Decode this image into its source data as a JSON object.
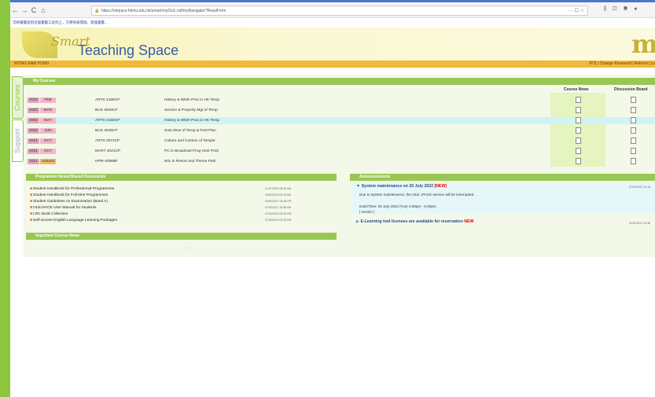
{
  "browser": {
    "nav": [
      "←",
      "→",
      "C",
      "⌂"
    ],
    "url": "https://olepace.hkmu.edu.hk/smart/myOLE.nsf/myNavigator?ReadForm",
    "url_icons": "··· ☐ ☆",
    "toolbar_icons": "⫼ ◫ ◉ ●",
    "notice": "可將書籤放到這個書籤工具列上，方便快速開啟。管理書籤..."
  },
  "header": {
    "logo_smart": "Smart",
    "logo_text": "Teaching Space",
    "brand_mark": "mu"
  },
  "userbar": {
    "username": "WONG KAM PONG",
    "links": [
      "中文",
      "Change Password",
      "Refresh",
      "Lo"
    ]
  },
  "side_tabs": [
    "Courses",
    "Support"
  ],
  "courses": {
    "title": "My Courses",
    "col_news": "Course News",
    "col_board": "Discussion Board",
    "rows": [
      {
        "year": "2022",
        "term": "FEB",
        "code": "ARTS 4158CP",
        "name": "History & Wksh Prac in HK Temp"
      },
      {
        "year": "2022",
        "term": "MAR",
        "code": "BUS 3028CP",
        "name": "Service & Property Mgt of Temp"
      },
      {
        "year": "2022",
        "term": "MAY",
        "code": "ARTS 4158CP",
        "name": "History & Wksh Prac in HK Temp"
      },
      {
        "year": "2022",
        "term": "JUN",
        "code": "BUS 4048CP",
        "name": "Sust deve of Temp & Fest Plan"
      },
      {
        "year": "2021",
        "term": "OCT",
        "code": "ARTS 3074CP",
        "name": "Culture and Custom of Temple"
      },
      {
        "year": "2021",
        "term": "OCT",
        "code": "MART 4021CP",
        "name": "PC in Broadcast Prog Host Prod"
      },
      {
        "year": "2021",
        "term": "Autumn",
        "code": "HPM 4098BF",
        "name": "WIL in Resort and Theme Park"
      }
    ]
  },
  "programme_news": {
    "title": "Programme News/Shared Documents",
    "items": [
      {
        "label": "Student Handbook for Professional Programmes",
        "date": "21/07/2016 09:33 AM"
      },
      {
        "label": "Student Handbook for Full-time Programmes",
        "date": "04/02/2019 09:13 AM"
      },
      {
        "label": "Student Guidelines on Examination (Band A)",
        "date": "03/02/2017 04:28 PM"
      },
      {
        "label": "OLEi.PACE User Manual for Students",
        "date": "07/02/2017 10:55 AM"
      },
      {
        "label": "LRC Book Collection",
        "date": "07/03/2019 02:53 PM"
      },
      {
        "label": "Self-access English Language Learning Packages",
        "date": "07/03/2019 02:23 PM"
      }
    ]
  },
  "important_news": {
    "title": "Important Course News",
    "placeholder": "-"
  },
  "announcements": {
    "title": "Announcements",
    "items": [
      {
        "marker": "▼",
        "title": "System maintenance on 26 July 2022",
        "badge": "[NEW]",
        "date": "07/25/2022 10:15",
        "body": "Due to system maintenance, the OLE i.PACE service will be interrupted.",
        "datetime": "Date/Time: 26 July 2022 (Tue) 3:00pm - 5:00pm",
        "details": "[ Details ]"
      },
      {
        "marker": "▶",
        "title": "E-Learning tool licenses are available for reservation",
        "badge": "NEW",
        "date": "11/22/2021 13:38"
      }
    ]
  }
}
